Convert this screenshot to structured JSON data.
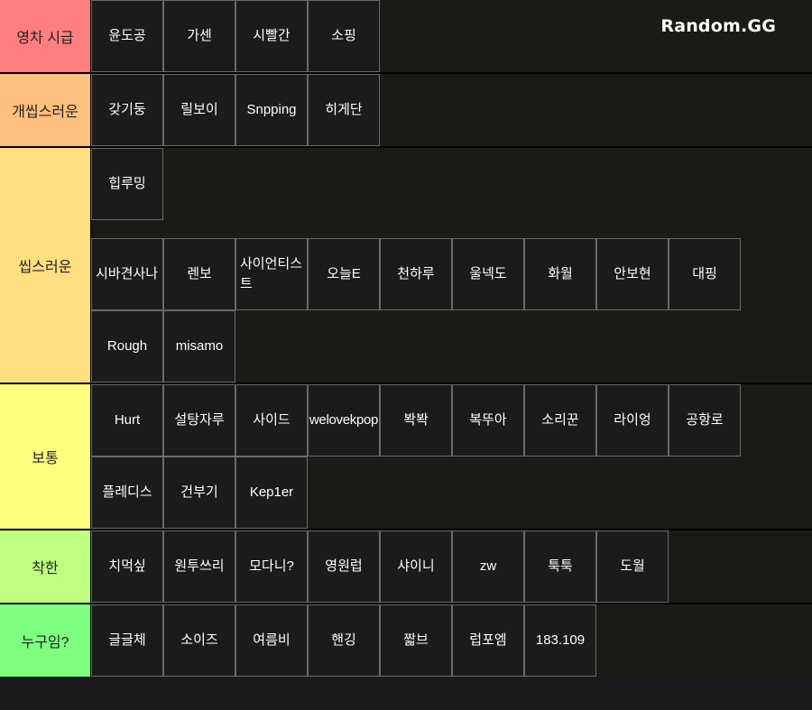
{
  "brand": "Random.GG",
  "tiers": [
    {
      "label": "영차 시급",
      "color": "#ff7f7f",
      "items": [
        "윤도공",
        "가센",
        "시빨간",
        "소핑"
      ]
    },
    {
      "label": "개씹스러운",
      "color": "#ffbf7f",
      "items": [
        "갖기둥",
        "릴보이",
        "Snpping",
        "히게단"
      ]
    },
    {
      "label": "씹스러운",
      "color": "#ffdf7f",
      "items": [
        "힙루밍",
        "시바견사나",
        "렌보",
        "사이언티스트",
        "오늘E",
        "천하루",
        "울넥도",
        "화월",
        "안보현",
        "대핑",
        "Rough",
        "misamo"
      ]
    },
    {
      "label": "보통",
      "color": "#ffff7f",
      "items": [
        "Hurt",
        "설탕자루",
        "사이드",
        "welovekpop",
        "봑봑",
        "복뚜아",
        "소리꾼",
        "라이엉",
        "공항로",
        "플레디스",
        "건부기",
        "Kep1er"
      ]
    },
    {
      "label": "착한",
      "color": "#bfff7f",
      "items": [
        "치먹싶",
        "원투쓰리",
        "모다니?",
        "영원럽",
        "샤이니",
        "zw",
        "툭툭",
        "도월"
      ]
    },
    {
      "label": "누구임?",
      "color": "#7fff7f",
      "items": [
        "글글체",
        "소이즈",
        "여름비",
        "핸깅",
        "짧브",
        "럽포엠",
        "183.109"
      ]
    }
  ]
}
